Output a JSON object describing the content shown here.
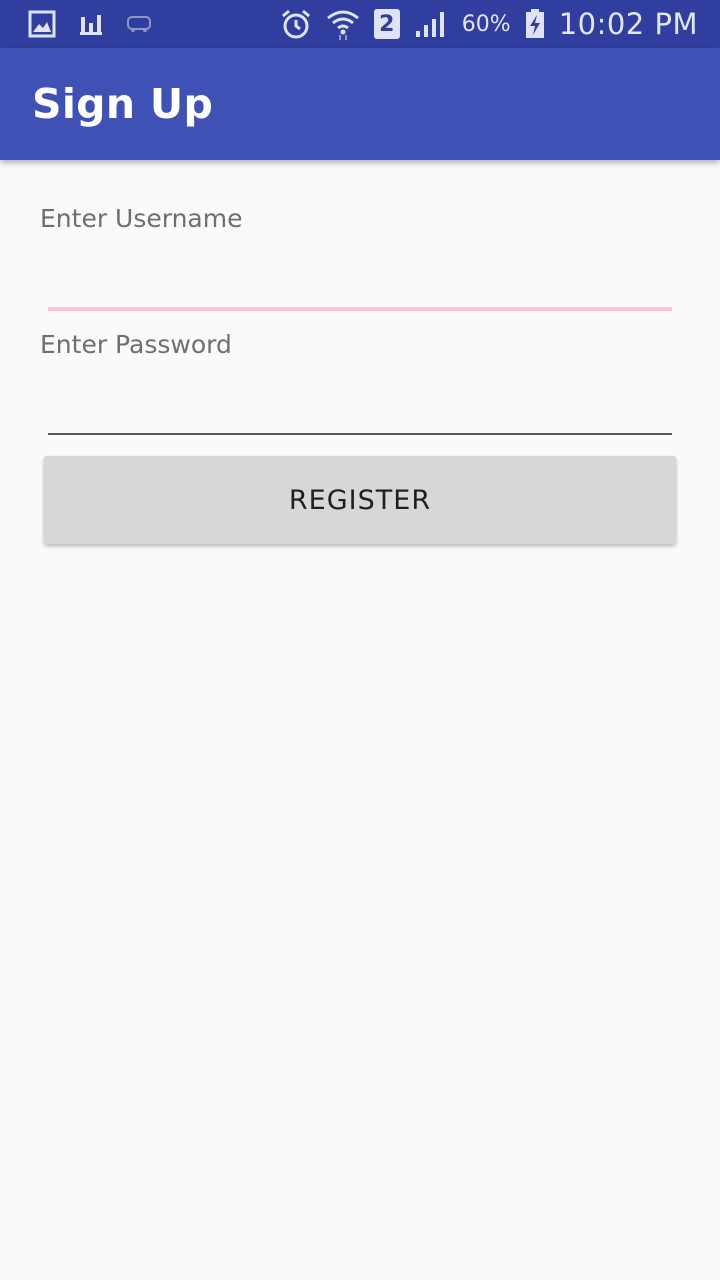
{
  "status_bar": {
    "left_icons": [
      "gallery-icon",
      "chart-icon",
      "redbus-icon"
    ],
    "right_icons": [
      "alarm-icon",
      "wifi-icon",
      "sim-2-icon",
      "signal-icon",
      "battery-charging-icon"
    ],
    "sim_label": "2",
    "battery": "60%",
    "time": "10:02 PM"
  },
  "app_bar": {
    "title": "Sign Up",
    "color": "#3f51b5",
    "status_color": "#303f9f"
  },
  "form": {
    "username_label": "Enter Username",
    "username_value": "",
    "password_label": "Enter Password",
    "password_value": "",
    "focused_underline_color": "#f7c5d3",
    "underline_color": "#5b5b5b"
  },
  "register_button": {
    "label": "REGISTER"
  }
}
